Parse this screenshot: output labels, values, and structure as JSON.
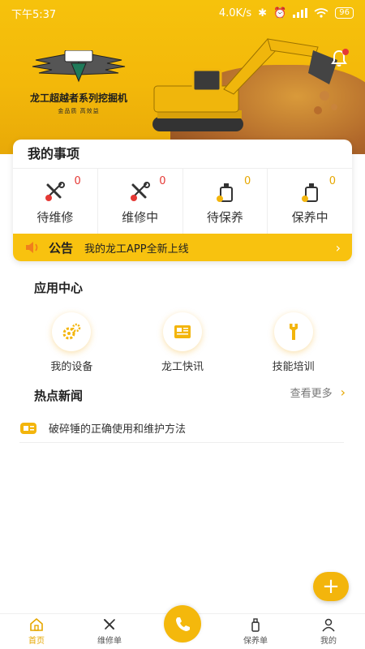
{
  "status_bar": {
    "time": "下午5:37",
    "speed": "4.0K/s",
    "battery": "96"
  },
  "banner": {
    "logo_title": "龙工超越者系列挖掘机",
    "logo_sub": "金品质 高效益",
    "has_notification": true
  },
  "my_items": {
    "title": "我的事项",
    "items": [
      {
        "label": "待维修",
        "count": "0",
        "icon": "wrench-screwdriver-icon"
      },
      {
        "label": "维修中",
        "count": "0",
        "icon": "wrench-screwdriver-icon"
      },
      {
        "label": "待保养",
        "count": "0",
        "icon": "oil-can-icon"
      },
      {
        "label": "保养中",
        "count": "0",
        "icon": "oil-can-icon"
      }
    ]
  },
  "notice": {
    "title": "公告",
    "text": "我的龙工APP全新上线"
  },
  "app_center": {
    "title": "应用中心",
    "apps": [
      {
        "label": "我的设备",
        "icon": "gears-icon"
      },
      {
        "label": "龙工快讯",
        "icon": "newspaper-icon"
      },
      {
        "label": "技能培训",
        "icon": "wrench-icon"
      }
    ]
  },
  "hot_news": {
    "title": "热点新闻",
    "more_label": "查看更多",
    "items": [
      {
        "title": "破碎锤的正确使用和维护方法"
      }
    ]
  },
  "bottom_nav": {
    "items": [
      {
        "label": "首页",
        "icon": "home-icon",
        "active": true
      },
      {
        "label": "维修单",
        "icon": "wrench-screwdriver-icon",
        "active": false
      },
      {
        "label": "",
        "icon": "phone-icon",
        "active": false
      },
      {
        "label": "保养单",
        "icon": "oil-bottle-icon",
        "active": false
      },
      {
        "label": "我的",
        "icon": "user-icon",
        "active": false
      }
    ]
  },
  "colors": {
    "brand": "#f4b80c",
    "notice_bg": "#f8c20f",
    "badge_red": "#e53935"
  }
}
